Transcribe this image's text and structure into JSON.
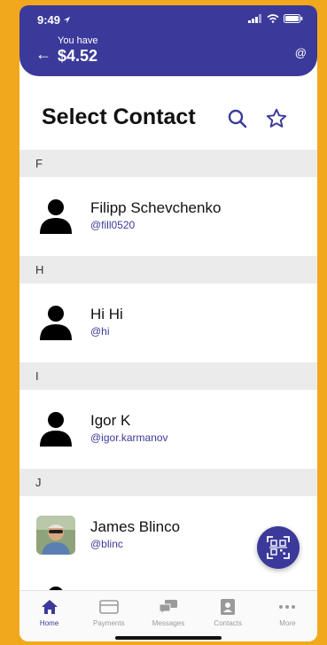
{
  "status": {
    "time": "9:49"
  },
  "header": {
    "you_have_label": "You have",
    "balance": "$4.52",
    "at_symbol": "@"
  },
  "page": {
    "title": "Select Contact"
  },
  "sections": [
    {
      "letter": "F",
      "contacts": [
        {
          "name": "Filipp Schevchenko",
          "handle": "@fill0520",
          "avatar": "person-silhouette-icon"
        }
      ]
    },
    {
      "letter": "H",
      "contacts": [
        {
          "name": "Hi Hi",
          "handle": "@hi",
          "avatar": "person-silhouette-icon"
        }
      ]
    },
    {
      "letter": "I",
      "contacts": [
        {
          "name": "Igor K",
          "handle": "@igor.karmanov",
          "avatar": "person-silhouette-icon"
        }
      ]
    },
    {
      "letter": "J",
      "contacts": [
        {
          "name": "James Blinco",
          "handle": "@blinc",
          "avatar": "photo"
        }
      ]
    }
  ],
  "tabs": [
    {
      "label": "Home",
      "icon": "home-icon",
      "active": true
    },
    {
      "label": "Payments",
      "icon": "card-icon",
      "active": false
    },
    {
      "label": "Messages",
      "icon": "chat-icon",
      "active": false
    },
    {
      "label": "Contacts",
      "icon": "contacts-icon",
      "active": false
    },
    {
      "label": "More",
      "icon": "more-icon",
      "active": false
    }
  ],
  "colors": {
    "brand": "#3b3a9a",
    "frame": "#f2a81d",
    "section_bg": "#ebebeb"
  }
}
